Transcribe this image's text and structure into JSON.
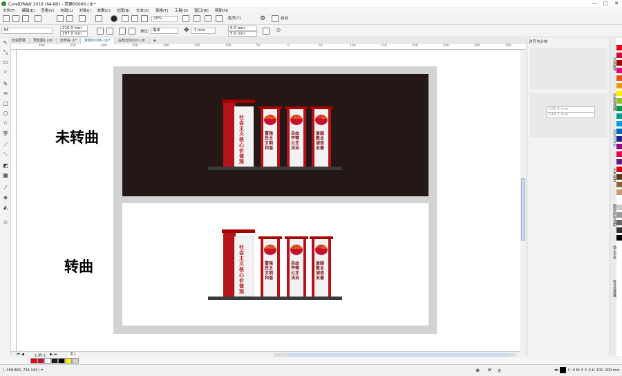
{
  "app": {
    "title": "CorelDRAW 2018 (64-Bit) - 党建00066.cdr*",
    "window_buttons": [
      "—",
      "□",
      "✕"
    ]
  },
  "menu": [
    "文件(F)",
    "编辑(E)",
    "查看(V)",
    "布局(L)",
    "对象(J)",
    "效果(C)",
    "位图(B)",
    "文本(X)",
    "表格(T)",
    "工具(O)",
    "窗口(W)",
    "帮助(H)"
  ],
  "toolbar1": {
    "zoom": "25%",
    "snap": "贴齐(T)",
    "launch": "启动"
  },
  "toolbar2": {
    "paper": "A4",
    "width": "210.0 mm",
    "height": "297.0 mm",
    "units_label": "单位:",
    "units": "毫米",
    "nudge": ".1 mm",
    "dup_x": "5.0 mm",
    "dup_y": "5.0 mm"
  },
  "tabs": [
    "欢迎屏幕",
    "预览图1.cdr",
    "未命名 -1*",
    "党建00066.cdr*",
    "古典云纹020.cdr"
  ],
  "active_tab": 3,
  "ruler_ticks": [
    "400",
    "350",
    "300",
    "250",
    "200",
    "150",
    "100",
    "50",
    "0",
    "50",
    "100",
    "150",
    "200",
    "250",
    "300",
    "350",
    "400"
  ],
  "canvas": {
    "label_top": "未转曲",
    "label_bottom": "转曲",
    "signs": {
      "main_text": "社会主义核心价值观",
      "panels": [
        {
          "badge": "国家层面",
          "text": "富强民主文明和谐"
        },
        {
          "badge": "社会层面",
          "text": "自由平等公正法治"
        },
        {
          "badge": "个人层面",
          "text": "爱国敬业诚信友善"
        }
      ]
    }
  },
  "docker": {
    "title": "对齐与分布",
    "values": [
      "105.0 mm",
      "148.5 mm"
    ],
    "tabs": [
      "对象属性",
      "对象管理器",
      "对齐与分布",
      "文本属性",
      "图层/颜色/透明",
      "插入字符",
      "符号管理器"
    ]
  },
  "palette": {
    "colors": [
      "#e60012",
      "#c8102e",
      "#a40000",
      "#e4007f",
      "#ea5514",
      "#f39800",
      "#fff100",
      "#8fc31f",
      "#009944",
      "#009e96",
      "#00a0e9",
      "#0068b7",
      "#1d2088",
      "#920783",
      "#e5004f",
      "#601986",
      "#d7000f",
      "#603813",
      "#8c6239",
      "#c69c6d",
      "#ffffff",
      "#cccccc",
      "#999999",
      "#666666",
      "#333333",
      "#000000"
    ]
  },
  "pages": {
    "indicator": "1 的 1",
    "page_tab": "页1"
  },
  "document_palette": [
    "#e60012",
    "#c8102e",
    "#ffffff",
    "#231816",
    "#000000",
    "#fff100",
    "#d3d3d3"
  ],
  "status": {
    "coords": "( -358.863, 734.143 )",
    "fill_label": "无",
    "outline_info": "C: 0 M: 0 Y: 0 K: 100  .200 mm"
  }
}
